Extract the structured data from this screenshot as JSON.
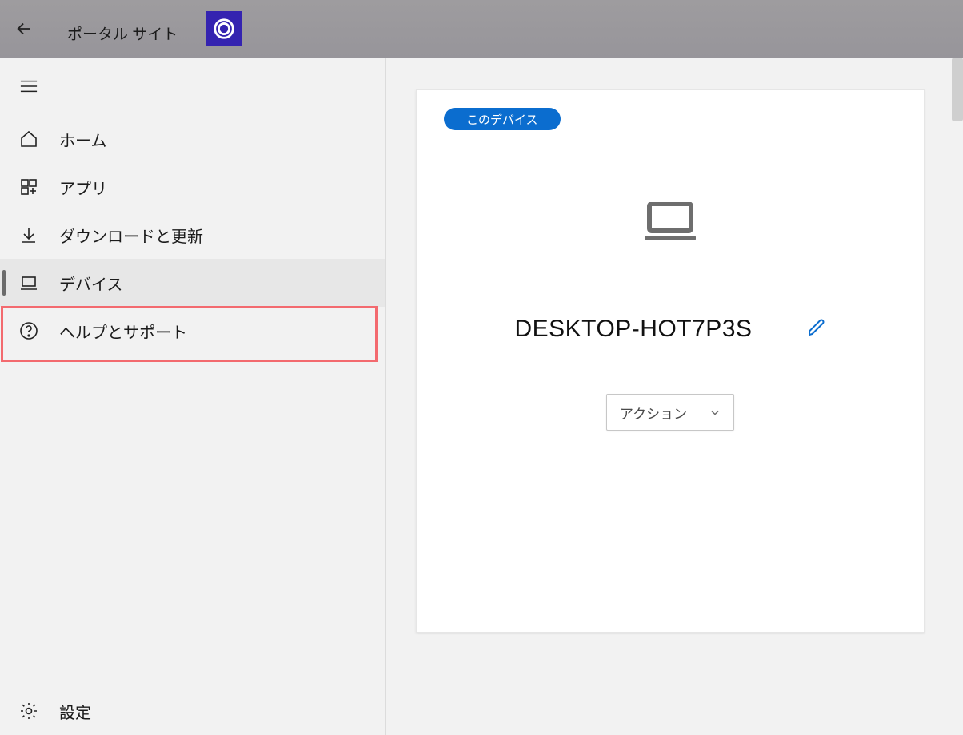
{
  "titlebar": {
    "title": "ポータル サイト"
  },
  "sidebar": {
    "items": [
      {
        "label": "ホーム"
      },
      {
        "label": "アプリ"
      },
      {
        "label": "ダウンロードと更新"
      },
      {
        "label": "デバイス"
      },
      {
        "label": "ヘルプとサポート"
      }
    ],
    "settings_label": "設定"
  },
  "main": {
    "badge_label": "このデバイス",
    "device_name": "DESKTOP-HOT7P3S",
    "action_label": "アクション"
  }
}
